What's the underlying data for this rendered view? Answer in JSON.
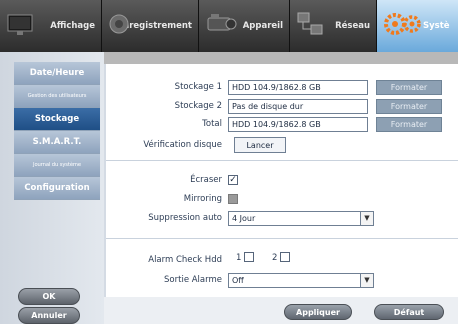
{
  "tabs": [
    {
      "label": "Affichage",
      "icon": "monitor-icon"
    },
    {
      "label": "Enregistrement",
      "icon": "record-icon"
    },
    {
      "label": "Appareil",
      "icon": "camera-icon"
    },
    {
      "label": "Réseau",
      "icon": "network-icon"
    },
    {
      "label": "Systè",
      "icon": "gears-icon"
    }
  ],
  "sidebar": {
    "items": [
      {
        "label": "Date/Heure"
      },
      {
        "label": "Gestion des utilisateurs"
      },
      {
        "label": "Stockage"
      },
      {
        "label": "S.M.A.R.T."
      },
      {
        "label": "Journal du système"
      },
      {
        "label": "Configuration"
      }
    ],
    "ok_label": "OK",
    "cancel_label": "Annuler"
  },
  "storage": {
    "rows": [
      {
        "label": "Stockage 1",
        "value": "HDD 104.9/1862.8 GB",
        "button": "Formater"
      },
      {
        "label": "Stockage 2",
        "value": "Pas de disque dur",
        "button": "Formater"
      },
      {
        "label": "Total",
        "value": "HDD 104.9/1862.8 GB",
        "button": "Formater"
      }
    ],
    "check_label": "Vérification disque",
    "check_button": "Lancer"
  },
  "options": {
    "overwrite_label": "Écraser",
    "overwrite_checked": true,
    "mirroring_label": "Mirroring",
    "mirroring_disabled": true,
    "auto_delete_label": "Suppression auto",
    "auto_delete_value": "4 Jour"
  },
  "alarm": {
    "check_label": "Alarm Check Hdd",
    "check_1": "1",
    "check_2": "2",
    "output_label": "Sortie Alarme",
    "output_value": "Off"
  },
  "footer": {
    "apply_label": "Appliquer",
    "default_label": "Défaut"
  },
  "colors": {
    "active_menu": "#2b5c95",
    "active_tab": "#6aa9db",
    "button_disabled": "#8da0b3"
  }
}
